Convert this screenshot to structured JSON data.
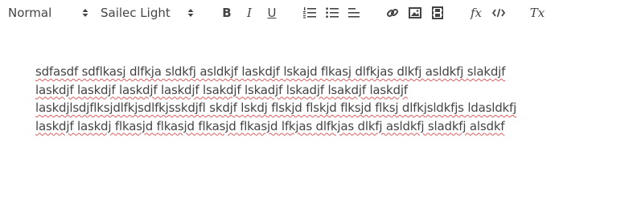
{
  "toolbar": {
    "header_select_value": "Normal",
    "font_select_value": "Sailec Light",
    "icons": {
      "bold": "bold-icon",
      "italic": "italic-icon",
      "underline": "underline-icon",
      "ordered_list": "ordered-list-icon",
      "bullet_list": "bullet-list-icon",
      "align": "align-icon",
      "link": "link-icon",
      "image": "image-icon",
      "video": "video-icon",
      "formula": "formula-icon",
      "code": "code-icon",
      "clear_format": "clear-format-icon"
    },
    "labels": {
      "bold": "B",
      "italic": "I",
      "underline": "U",
      "formula": "fx",
      "clean": "Tx"
    }
  },
  "editor": {
    "text": "sdfasdf sdflkasj dlfkja sldkfj asldkjf laskdjf lskajd flkasj dlfkjas dlkfj asldkfj slakdjf\nlaskdjf laskdjf laskdjf laskdjf lsakdjf lskadjf lskadjf lsakdjf laskdjf\nlaskdjlsdjflksjdlfkjsdlfkjsskdjfl skdjf lskdj flskjd flskjd flksjd flksj dlfkjsldkfjs ldasldkfj\nlaskdjf laskdj flkasjd flkasjd flkasjd flkasjd lfkjas dlfkjas dlkfj asldkfj sladkfj alsdkf"
  },
  "colors": {
    "text": "#444444",
    "spellcheck_underline": "#e05c5c"
  }
}
